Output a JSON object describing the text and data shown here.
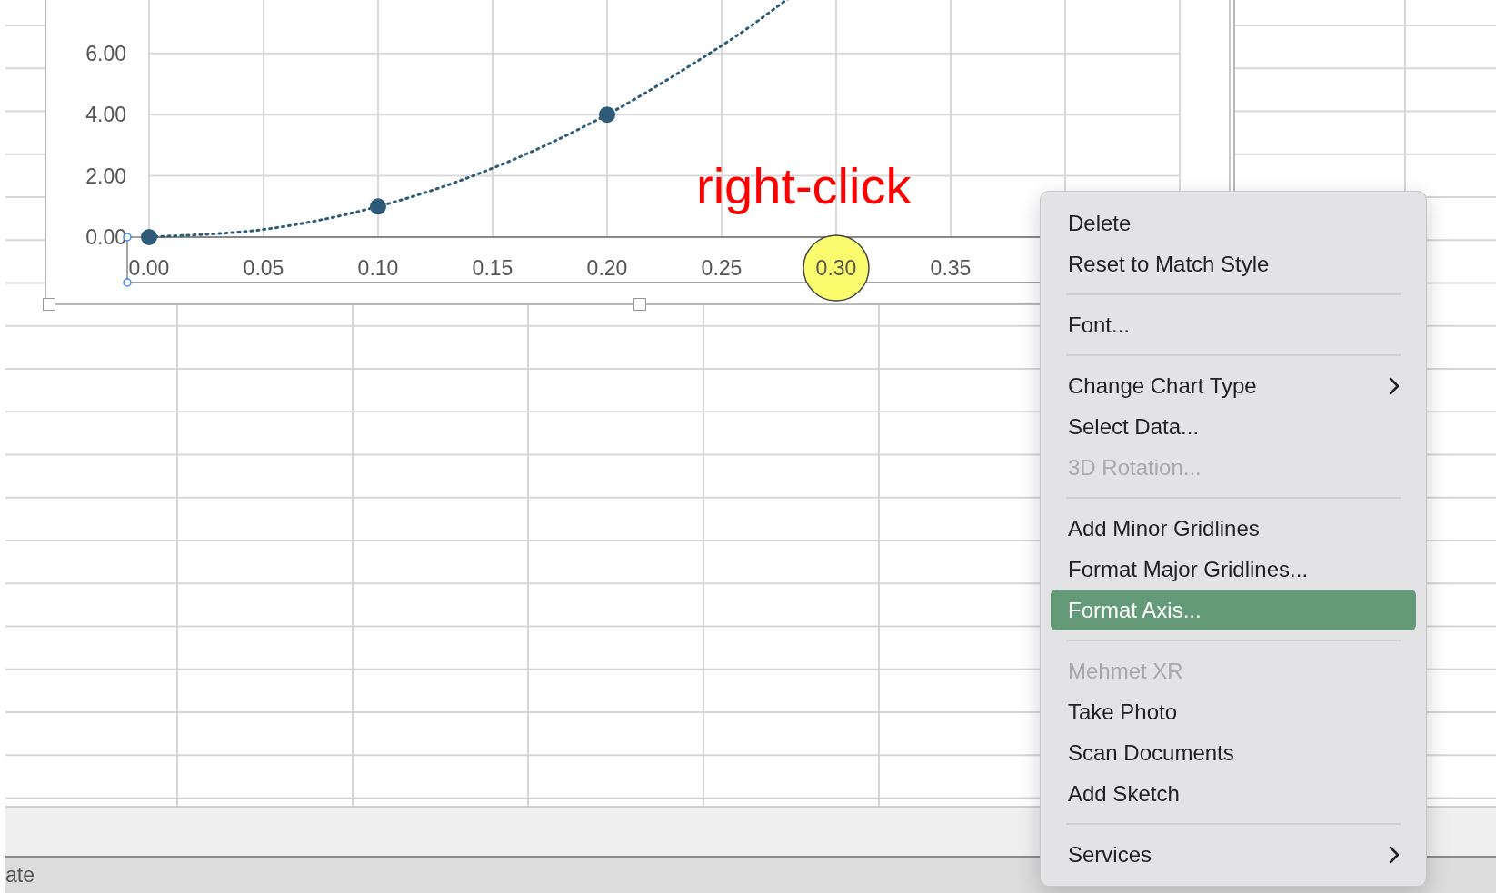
{
  "chart": {
    "x_axis": {
      "selected": true
    },
    "chart_data": {
      "type": "scatter",
      "x": [
        0,
        0.05,
        0.1,
        0.15,
        0.2,
        0.25,
        0.279
      ],
      "xlim": [
        0,
        0.45
      ],
      "ylim": [
        0,
        7.8
      ],
      "grid": true,
      "series": [
        {
          "type": "scatter",
          "color": "#2d5b78",
          "values": [
            0,
            null,
            1,
            null,
            4,
            null,
            null
          ]
        },
        {
          "type": "line",
          "line_style": "dotted",
          "color": "#2d5b78",
          "values": [
            0,
            0.25,
            1,
            2.25,
            4,
            6.25,
            7.78
          ]
        }
      ],
      "xticks": [
        {
          "value": 0,
          "label": "0.00"
        },
        {
          "value": 0.05,
          "label": "0.05"
        },
        {
          "value": 0.1,
          "label": "0.10"
        },
        {
          "value": 0.15,
          "label": "0.15"
        },
        {
          "value": 0.2,
          "label": "0.20"
        },
        {
          "value": 0.25,
          "label": "0.25"
        },
        {
          "value": 0.3,
          "label": "0.30"
        },
        {
          "value": 0.35,
          "label": "0.35"
        }
      ],
      "yticks": [
        {
          "value": 0,
          "label": "0.00"
        },
        {
          "value": 2,
          "label": "2.00"
        },
        {
          "value": 4,
          "label": "4.00"
        },
        {
          "value": 6,
          "label": "6.00"
        }
      ]
    }
  },
  "annotation": {
    "text": "right-click"
  },
  "context_menu": {
    "groups": [
      [
        {
          "label": "Delete",
          "disabled": false,
          "selected": false,
          "submenu": false
        },
        {
          "label": "Reset to Match Style",
          "disabled": false,
          "selected": false,
          "submenu": false
        }
      ],
      [
        {
          "label": "Font...",
          "disabled": false,
          "selected": false,
          "submenu": false
        }
      ],
      [
        {
          "label": "Change Chart Type",
          "disabled": false,
          "selected": false,
          "submenu": true
        },
        {
          "label": "Select Data...",
          "disabled": false,
          "selected": false,
          "submenu": false
        },
        {
          "label": "3D Rotation...",
          "disabled": true,
          "selected": false,
          "submenu": false
        }
      ],
      [
        {
          "label": "Add Minor Gridlines",
          "disabled": false,
          "selected": false,
          "submenu": false
        },
        {
          "label": "Format Major Gridlines...",
          "disabled": false,
          "selected": false,
          "submenu": false
        },
        {
          "label": "Format Axis...",
          "disabled": false,
          "selected": true,
          "submenu": false
        }
      ],
      [
        {
          "label": "Mehmet XR",
          "disabled": true,
          "selected": false,
          "submenu": false
        },
        {
          "label": "Take Photo",
          "disabled": false,
          "selected": false,
          "submenu": false
        },
        {
          "label": "Scan Documents",
          "disabled": false,
          "selected": false,
          "submenu": false
        },
        {
          "label": "Add Sketch",
          "disabled": false,
          "selected": false,
          "submenu": false
        }
      ],
      [
        {
          "label": "Services",
          "disabled": false,
          "selected": false,
          "submenu": true
        }
      ]
    ]
  },
  "status_bar": {
    "text": "ate"
  }
}
